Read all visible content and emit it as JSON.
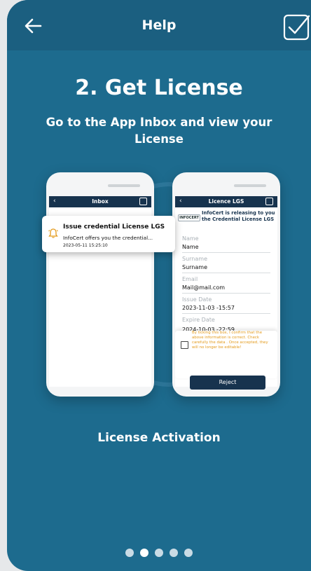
{
  "header": {
    "title": "Help",
    "back_icon": "arrow-left-icon",
    "confirm_icon": "checkbox-checked-icon"
  },
  "step": {
    "title": "2. Get License",
    "subtitle": "Go to the App Inbox and view your License"
  },
  "inbox_phone": {
    "bar_title": "Inbox",
    "notification": {
      "title": "Issue credential License LGS",
      "body": "InfoCert offers you the credential...",
      "time": "2023-05-11 15:25:10",
      "icon": "bell-icon"
    }
  },
  "licence_phone": {
    "bar_title": "Licence LGS",
    "logo_text": "INFOCERT",
    "intro": "InfoCert is releasing to you the Credential License LGS",
    "fields": [
      {
        "label": "Name",
        "value": "Name"
      },
      {
        "label": "Surname",
        "value": "Surname"
      },
      {
        "label": "Email",
        "value": "Mail@mail.com"
      },
      {
        "label": "Issue Date",
        "value": "2023-11-03 -15:57"
      },
      {
        "label": "Expire Date",
        "value": "2024-10-03 -22:59"
      }
    ],
    "consent_text": "By ticking this box, I confirm that the above information is correct. Check carefully the data . Once accepted, they will no longer be editable!",
    "reject_label": "Reject"
  },
  "caption": "License Activation",
  "pagination": {
    "total": 5,
    "active": 1
  },
  "colors": {
    "background": "#1d6b8e",
    "header": "#1b5f80",
    "navy": "#17334e",
    "warning": "#e39a1b"
  }
}
